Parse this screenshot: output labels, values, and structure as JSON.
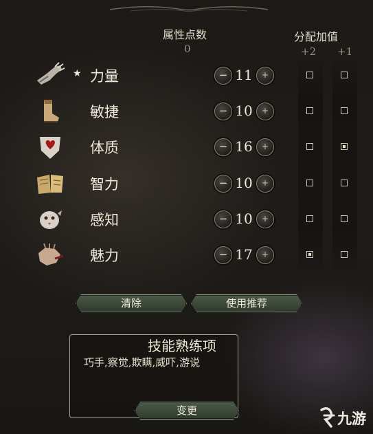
{
  "header": {
    "points_label": "属性点数",
    "points_value": "0",
    "bonus_label": "分配加值",
    "bonus_plus2": "+2",
    "bonus_plus1": "+1"
  },
  "attributes": [
    {
      "name": "力量",
      "value": "11",
      "starred": true,
      "plus2": false,
      "plus1": false,
      "icon": "gauntlet-icon"
    },
    {
      "name": "敏捷",
      "value": "10",
      "starred": false,
      "plus2": false,
      "plus1": false,
      "icon": "boot-icon"
    },
    {
      "name": "体质",
      "value": "16",
      "starred": false,
      "plus2": false,
      "plus1": true,
      "icon": "heart-shield-icon"
    },
    {
      "name": "智力",
      "value": "10",
      "starred": false,
      "plus2": false,
      "plus1": false,
      "icon": "book-icon"
    },
    {
      "name": "感知",
      "value": "10",
      "starred": false,
      "plus2": false,
      "plus1": false,
      "icon": "owlbear-icon"
    },
    {
      "name": "魅力",
      "value": "17",
      "starred": false,
      "plus2": true,
      "plus1": false,
      "icon": "hands-icon"
    }
  ],
  "controls": {
    "minus_symbol": "−",
    "plus_symbol": "+",
    "star_symbol": "★"
  },
  "buttons": {
    "clear": "清除",
    "recommend": "使用推荐",
    "change": "变更"
  },
  "skills": {
    "title": "技能熟练项",
    "list": "巧手,察觉,欺瞒,威吓,游说"
  },
  "watermark": {
    "text": "九游"
  },
  "colors": {
    "button_green": "#3d4a3a",
    "text_light": "#efe8d8",
    "text_muted": "#9b9486"
  }
}
